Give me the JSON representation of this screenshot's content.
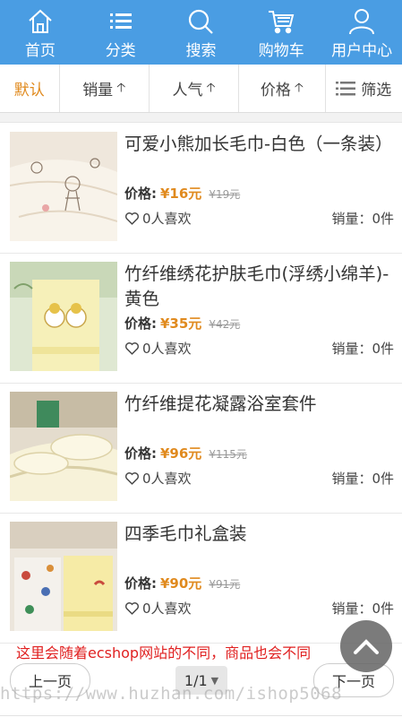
{
  "topnav": {
    "items": [
      {
        "label": "首页",
        "icon": "home-icon"
      },
      {
        "label": "分类",
        "icon": "list-icon"
      },
      {
        "label": "搜索",
        "icon": "search-icon"
      },
      {
        "label": "购物车",
        "icon": "cart-icon"
      },
      {
        "label": "用户中心",
        "icon": "user-icon"
      }
    ]
  },
  "sort": {
    "default": "默认",
    "sales": "销量",
    "popularity": "人气",
    "price": "价格",
    "filter": "筛选",
    "active_color": "#e08a1e"
  },
  "products": [
    {
      "name": "可爱小熊加长毛巾-白色（一条装）",
      "price_label": "价格:",
      "price": "¥16元",
      "old_price": "¥19元",
      "likes": "0人喜欢",
      "sales": "销量：0件"
    },
    {
      "name": "竹纤维绣花护肤毛巾(浮绣小绵羊)-黄色",
      "price_label": "价格:",
      "price": "¥35元",
      "old_price": "¥42元",
      "likes": "0人喜欢",
      "sales": "销量：0件"
    },
    {
      "name": "竹纤维提花凝露浴室套件",
      "price_label": "价格:",
      "price": "¥96元",
      "old_price": "¥115元",
      "likes": "0人喜欢",
      "sales": "销量：0件"
    },
    {
      "name": "四季毛巾礼盒装",
      "price_label": "价格:",
      "price": "¥90元",
      "old_price": "¥91元",
      "likes": "0人喜欢",
      "sales": "销量：0件"
    }
  ],
  "notice": "这里会随着ecshop网站的不同，商品也会不同",
  "pager": {
    "prev": "上一页",
    "next": "下一页",
    "current": "1/1"
  },
  "watermark": "https://www.huzhan.com/ishop5068",
  "colors": {
    "header": "#4a9de3",
    "price": "#e08a1e",
    "notice": "#e02020"
  }
}
